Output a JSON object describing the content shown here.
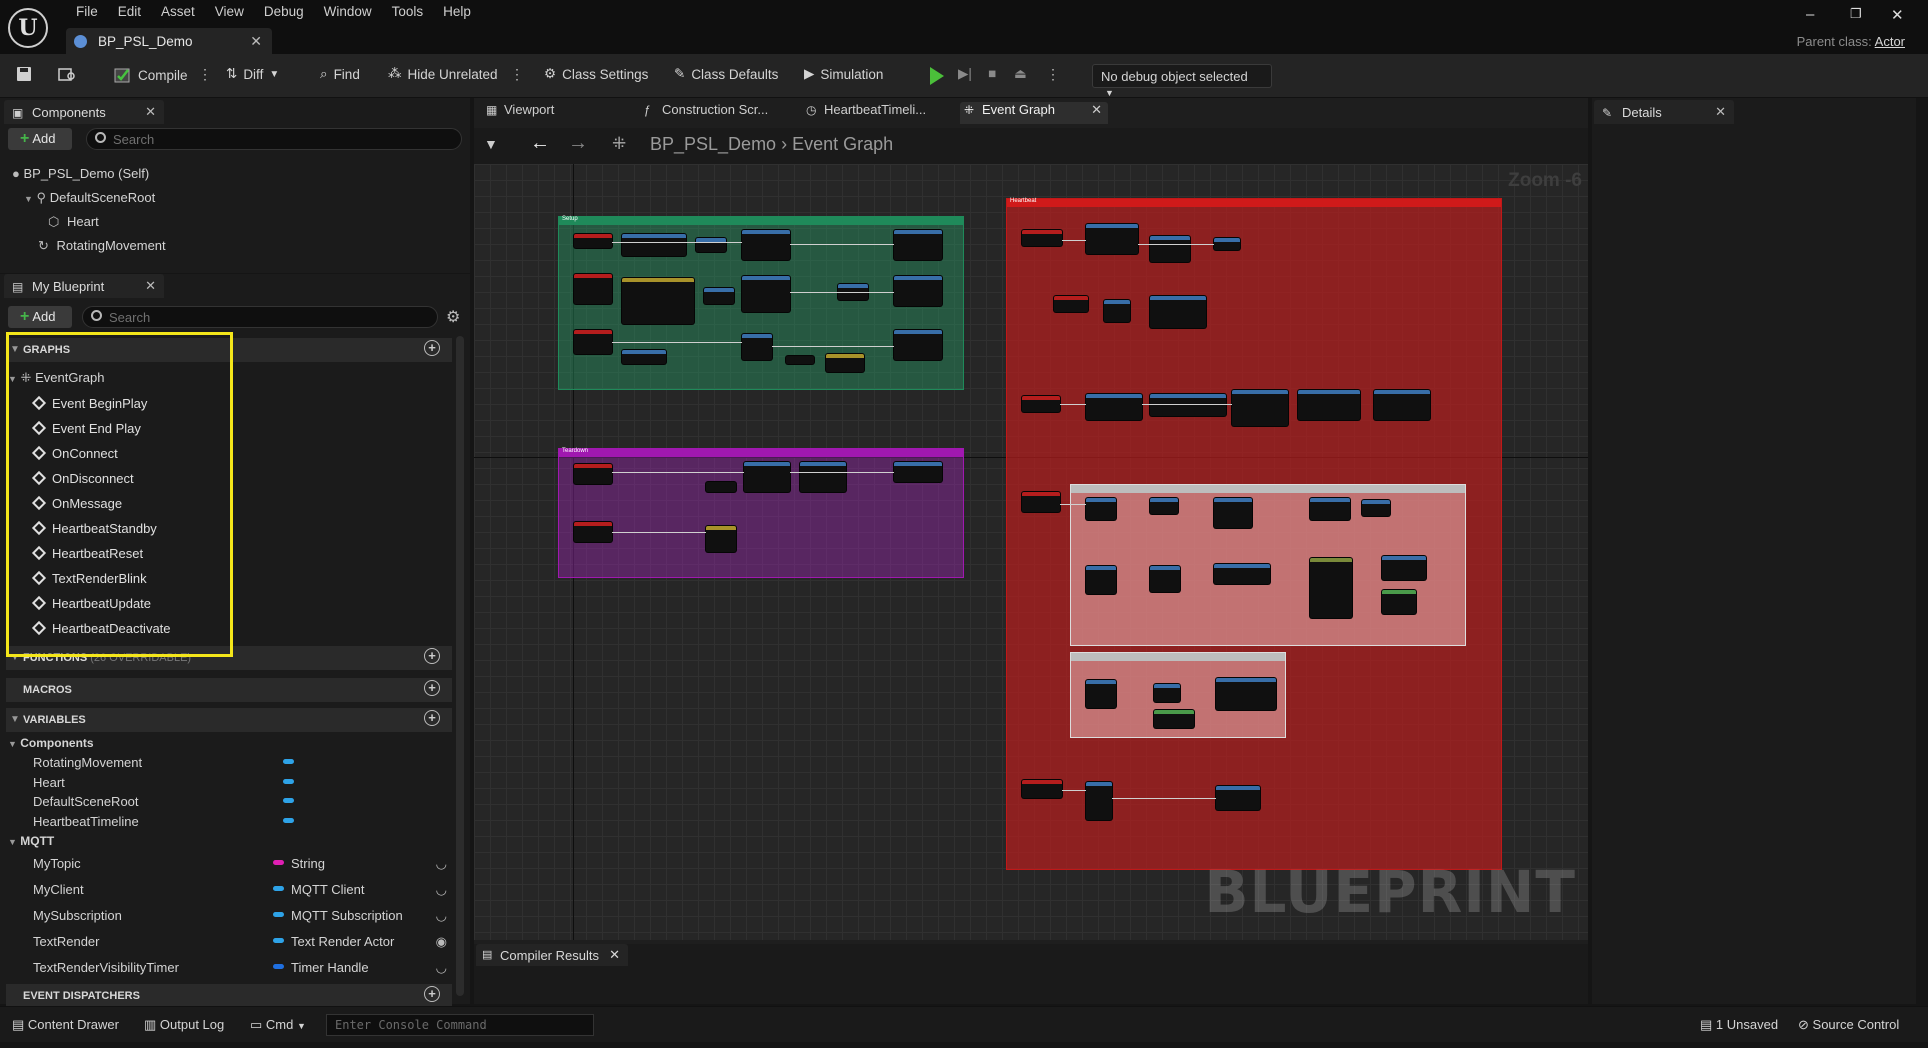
{
  "title_bar": {
    "menu": [
      "File",
      "Edit",
      "Asset",
      "View",
      "Debug",
      "Window",
      "Tools",
      "Help"
    ],
    "document_tab": "BP_PSL_Demo",
    "parent_class_label": "Parent class:",
    "parent_class_value": "Actor"
  },
  "toolbar": {
    "compile": "Compile",
    "diff": "Diff",
    "find": "Find",
    "hide_unrelated": "Hide Unrelated",
    "class_settings": "Class Settings",
    "class_defaults": "Class Defaults",
    "simulation": "Simulation",
    "debug_object": "No debug object selected"
  },
  "components_panel": {
    "tab": "Components",
    "add": "Add",
    "search_placeholder": "Search",
    "tree": [
      "BP_PSL_Demo (Self)",
      "DefaultSceneRoot",
      "Heart",
      "RotatingMovement"
    ]
  },
  "my_blueprint": {
    "tab": "My Blueprint",
    "add": "Add",
    "search_placeholder": "Search",
    "sections": {
      "graphs": "GRAPHS",
      "functions": "FUNCTIONS",
      "functions_note": "(26 OVERRIDABLE)",
      "macros": "MACROS",
      "variables": "VARIABLES",
      "event_dispatchers": "EVENT DISPATCHERS"
    },
    "event_graph": "EventGraph",
    "events": [
      "Event BeginPlay",
      "Event End Play",
      "OnConnect",
      "OnDisconnect",
      "OnMessage",
      "HeartbeatStandby",
      "HeartbeatReset",
      "TextRenderBlink",
      "HeartbeatUpdate",
      "HeartbeatDeactivate"
    ],
    "var_groups": {
      "components": "Components",
      "mqtt": "MQTT"
    },
    "component_vars": [
      "RotatingMovement",
      "Heart",
      "DefaultSceneRoot",
      "HeartbeatTimeline"
    ],
    "mqtt_vars": [
      {
        "name": "MyTopic",
        "type": "String",
        "color": "#e01fb4"
      },
      {
        "name": "MyClient",
        "type": "MQTT Client",
        "color": "#2ea3e8"
      },
      {
        "name": "MySubscription",
        "type": "MQTT Subscription",
        "color": "#2ea3e8"
      },
      {
        "name": "TextRender",
        "type": "Text Render Actor",
        "color": "#2ea3e8"
      },
      {
        "name": "TextRenderVisibilityTimer",
        "type": "Timer Handle",
        "color": "#1f6fe0"
      }
    ]
  },
  "graph_tabs": [
    "Viewport",
    "Construction Scr...",
    "HeartbeatTimeli...",
    "Event Graph"
  ],
  "breadcrumb": {
    "root": "BP_PSL_Demo",
    "current": "Event Graph"
  },
  "zoom": "Zoom -6",
  "watermark": "BLUEPRINT",
  "comments": {
    "setup": "Setup",
    "teardown": "Teardown",
    "heartbeat": "Heartbeat"
  },
  "compiler_tab": "Compiler Results",
  "details_tab": "Details",
  "status_bar": {
    "content_drawer": "Content Drawer",
    "output_log": "Output Log",
    "cmd": "Cmd",
    "console_placeholder": "Enter Console Command",
    "unsaved": "1 Unsaved",
    "source_control": "Source Control"
  },
  "colors": {
    "setup_comment": "#1f8a5a",
    "teardown_comment": "#a018b0",
    "heartbeat_comment": "#c01818",
    "highlight": "#f4e61a"
  }
}
